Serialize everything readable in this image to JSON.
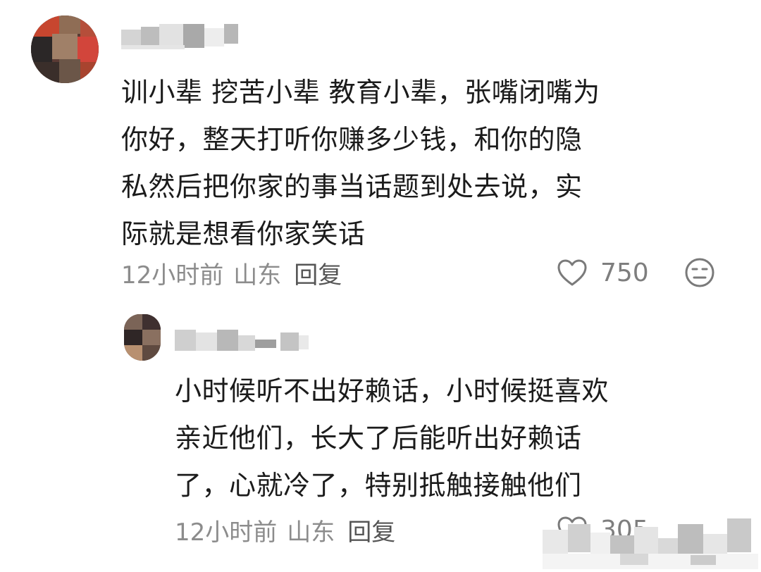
{
  "main_comment": {
    "text_lines": [
      "训小辈 挖苦小辈 教育小辈，张嘴闭嘴为",
      "你好，整天打听你赚多少钱，和你的隐",
      "私然后把你家的事当话题到处去说，实",
      "际就是想看你家笑话"
    ],
    "time": "12小时前",
    "location": "山东",
    "reply_label": "回复",
    "like_count": "750",
    "like_icon": "heart-outline-icon",
    "dislike_icon": "neutral-face-icon"
  },
  "reply_comment": {
    "text_lines": [
      "小时候听不出好赖话，小时候挺喜欢",
      "亲近他们，长大了后能听出好赖话",
      "了，心就冷了，特别抵触接触他们"
    ],
    "time": "12小时前",
    "location": "山东",
    "reply_label": "回复",
    "like_count": "305",
    "like_icon": "heart-outline-icon"
  },
  "colors": {
    "text_primary": "#1b1b1b",
    "text_meta": "#8c8c8c",
    "icon_gray": "#7a7a7a"
  }
}
